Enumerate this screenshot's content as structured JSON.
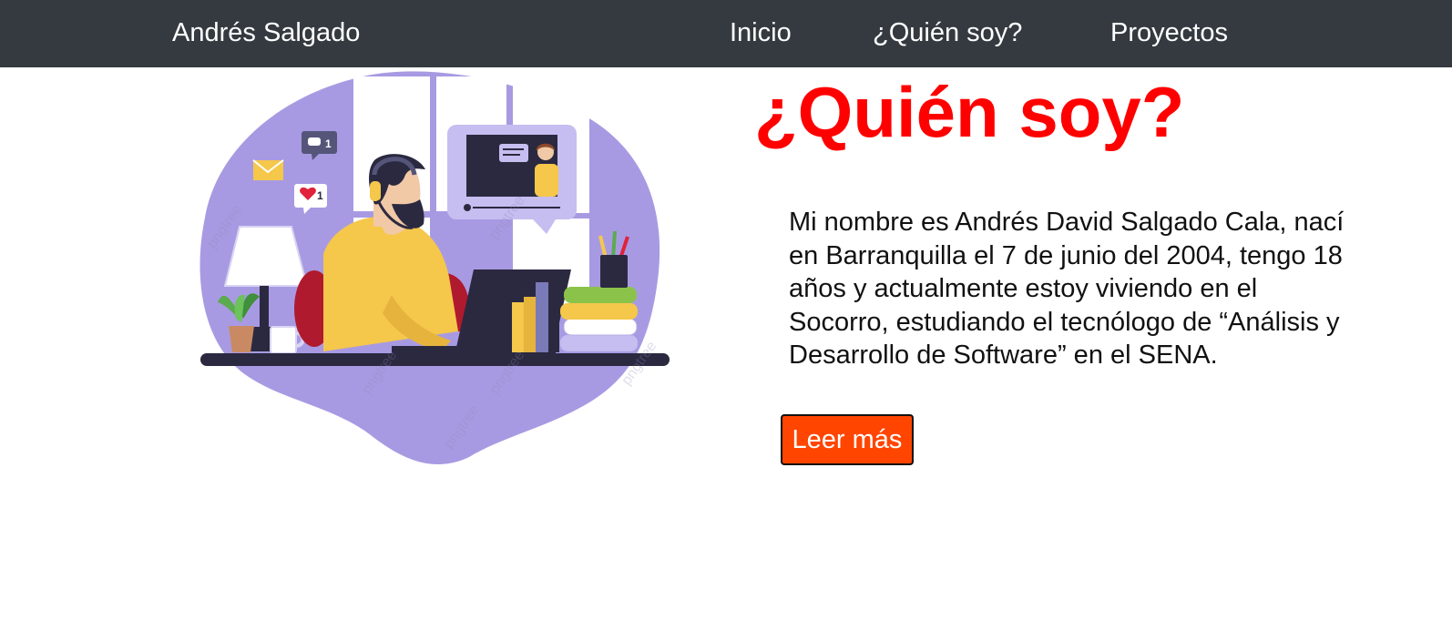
{
  "navbar": {
    "brand": "Andrés Salgado",
    "links": [
      {
        "label": "Inicio"
      },
      {
        "label": "¿Quién soy?"
      },
      {
        "label": "Proyectos"
      }
    ]
  },
  "main": {
    "heading": "¿Quién soy?",
    "bio": "Mi nombre es Andrés David Salgado Cala, nací en Barranquilla el 7 de junio del 2004, tengo 18 años y actualmente estoy viviendo en el Socorro, estudiando el tecnólogo de “Análisis y Desarrollo de Software” en el SENA.",
    "button_label": "Leer más",
    "illustration": {
      "name": "person-studying-online-illustration",
      "chat_badge": "1",
      "like_badge": "1",
      "watermark": "pngtree"
    }
  },
  "colors": {
    "navbar_bg": "#343a40",
    "heading": "#ff0000",
    "button_bg": "#ff4500",
    "illustration_purple": "#a89ae2"
  }
}
